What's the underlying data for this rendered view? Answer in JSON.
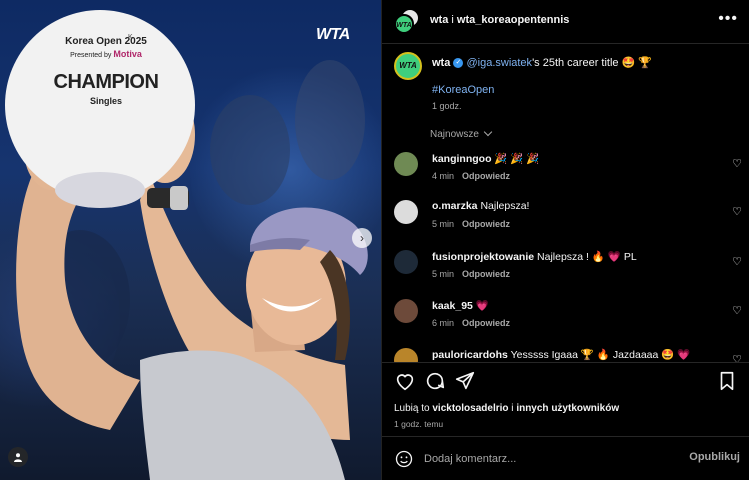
{
  "photo": {
    "watermark": "WTA",
    "trophy": {
      "brand": "K",
      "event": "Korea Open 2025",
      "presented": "Presented by",
      "sponsor": "Motiva",
      "champion": "CHAMPION",
      "category": "Singles"
    },
    "next_icon": "chevron-right-icon",
    "tag_icon": "user-icon"
  },
  "header": {
    "account1": "wta",
    "connector": "i",
    "account2": "wta_koreaopentennis",
    "more_icon": "more-horizontal-icon"
  },
  "caption": {
    "avatar_text": "WTA",
    "username": "wta",
    "mention": "@iga.swiatek",
    "text": "'s 25th career title 🤩 🏆",
    "hashtag": "#KoreaOpen",
    "time": "1 godz."
  },
  "sort_label": "Najnowsze",
  "comments": [
    {
      "user": "kanginngoo",
      "text": "🎉 🎉 🎉",
      "time": "4 min",
      "reply": "Odpowiedz",
      "avatar_color": "#6f8a54"
    },
    {
      "user": "o.marzka",
      "text": "Najlepsza!",
      "time": "5 min",
      "reply": "Odpowiedz",
      "avatar_color": "#dcdcdc"
    },
    {
      "user": "fusionprojektowanie",
      "text": "Najlepsza ! 🔥 💗 PL",
      "time": "5 min",
      "reply": "Odpowiedz",
      "avatar_color": "#1e2a38"
    },
    {
      "user": "kaak_95",
      "text": "💗",
      "time": "6 min",
      "reply": "Odpowiedz",
      "avatar_color": "#6d4a3a"
    },
    {
      "user": "pauloricardohs",
      "text": "Yesssss Igaaa 🏆 🔥 Jazdaaaa 🤩 💗",
      "time": "",
      "reply": "",
      "avatar_color": "#b9852a"
    }
  ],
  "actions": {
    "like_icon": "heart-icon",
    "comment_icon": "comment-icon",
    "share_icon": "send-icon",
    "save_icon": "bookmark-icon"
  },
  "likes": {
    "prefix": "Lubią to",
    "user": "vicktolosadelrio",
    "middle": "i",
    "others": "innych użytkowników"
  },
  "post_time": "1 godz. temu",
  "add_comment": {
    "emoji_icon": "emoji-icon",
    "placeholder": "Dodaj komentarz...",
    "publish": "Opublikuj"
  },
  "colors": {
    "accent_link": "#7fb2f0",
    "wta_green": "#3fcf7d",
    "muted": "#a8a8a8",
    "verified": "#3897f0"
  }
}
